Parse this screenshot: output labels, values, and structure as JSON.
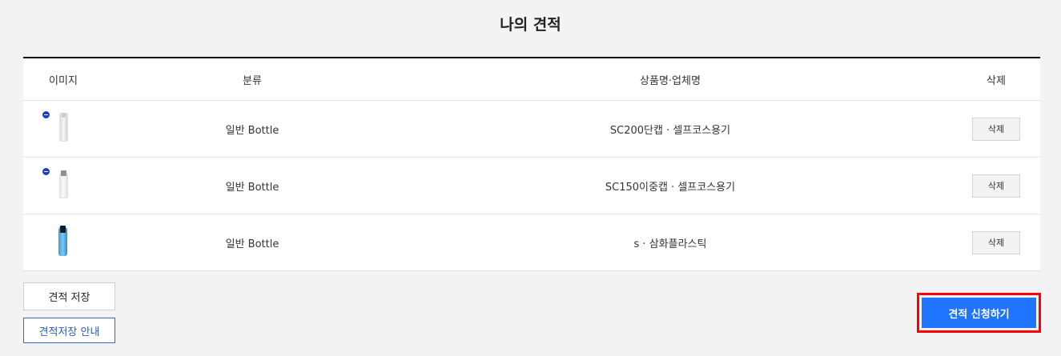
{
  "page": {
    "title": "나의 견적"
  },
  "table": {
    "headers": {
      "image": "이미지",
      "category": "분류",
      "product": "상품명·업체명",
      "delete": "삭제"
    },
    "rows": [
      {
        "image": "clear-bottle",
        "category": "일반 Bottle",
        "product": "SC200단캡 · 셀프코스용기",
        "delete_label": "삭제"
      },
      {
        "image": "silver-cap-bottle",
        "category": "일반 Bottle",
        "product": "SC150이중캡 · 셀프코스용기",
        "delete_label": "삭제"
      },
      {
        "image": "blue-bottle",
        "category": "일반 Bottle",
        "product": "s · 삼화플라스틱",
        "delete_label": "삭제"
      }
    ]
  },
  "actions": {
    "save_label": "견적 저장",
    "guide_label": "견적저장 안내",
    "apply_label": "견적 신청하기"
  },
  "colors": {
    "background": "#f3f3f3",
    "accent": "#1f75ff",
    "highlight_outline": "#ff0000",
    "guide_border": "#2b6dc9"
  }
}
